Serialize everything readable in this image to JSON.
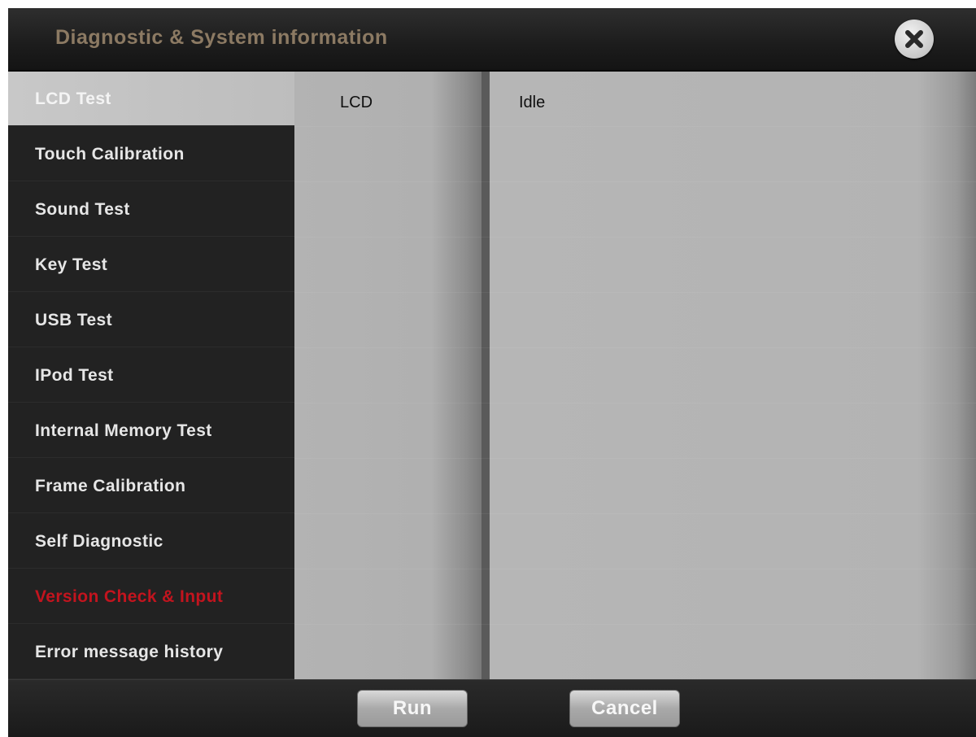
{
  "window": {
    "title": "Diagnostic & System information",
    "close_icon": "close-icon"
  },
  "sidebar": {
    "items": [
      {
        "label": "LCD Test",
        "state": "selected"
      },
      {
        "label": "Touch Calibration"
      },
      {
        "label": "Sound Test"
      },
      {
        "label": "Key Test"
      },
      {
        "label": "USB Test"
      },
      {
        "label": "IPod Test"
      },
      {
        "label": "Internal Memory Test"
      },
      {
        "label": "Frame Calibration"
      },
      {
        "label": "Self Diagnostic"
      },
      {
        "label": "Version Check & Input",
        "color": "#c3141e"
      },
      {
        "label": "Error message history"
      }
    ]
  },
  "results": {
    "item": "LCD",
    "status": "Idle"
  },
  "footer": {
    "run_label": "Run",
    "cancel_label": "Cancel"
  }
}
